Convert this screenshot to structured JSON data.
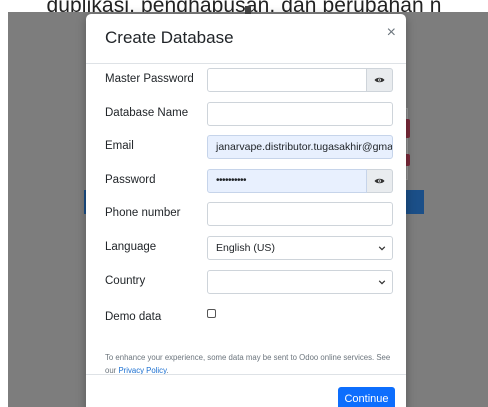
{
  "background": {
    "caption": "duplikasi, penghapusan, dan perubahan n"
  },
  "modal": {
    "title": "Create Database",
    "close_symbol": "×"
  },
  "form": {
    "master_password": {
      "label": "Master Password",
      "value": ""
    },
    "database_name": {
      "label": "Database Name",
      "value": ""
    },
    "email": {
      "label": "Email",
      "value": "janarvape.distributor.tugasakhir@gmai"
    },
    "password": {
      "label": "Password",
      "value": "••••••••••"
    },
    "phone_number": {
      "label": "Phone number",
      "value": ""
    },
    "language": {
      "label": "Language",
      "selected": "English (US)"
    },
    "country": {
      "label": "Country",
      "selected": ""
    },
    "demo_data": {
      "label": "Demo data",
      "checked": false
    }
  },
  "notice": {
    "text": "To enhance your experience, some data may be sent to Odoo online services. See our ",
    "link": "Privacy Policy",
    "suffix": "."
  },
  "footer": {
    "continue_label": "Continue"
  },
  "colors": {
    "primary": "#0d6efd",
    "link": "#1a6fd1",
    "autofill": "#e8f0fe"
  },
  "icons": {
    "eye": "eye-icon",
    "caret": "chevron-down-icon",
    "close": "close-icon"
  }
}
